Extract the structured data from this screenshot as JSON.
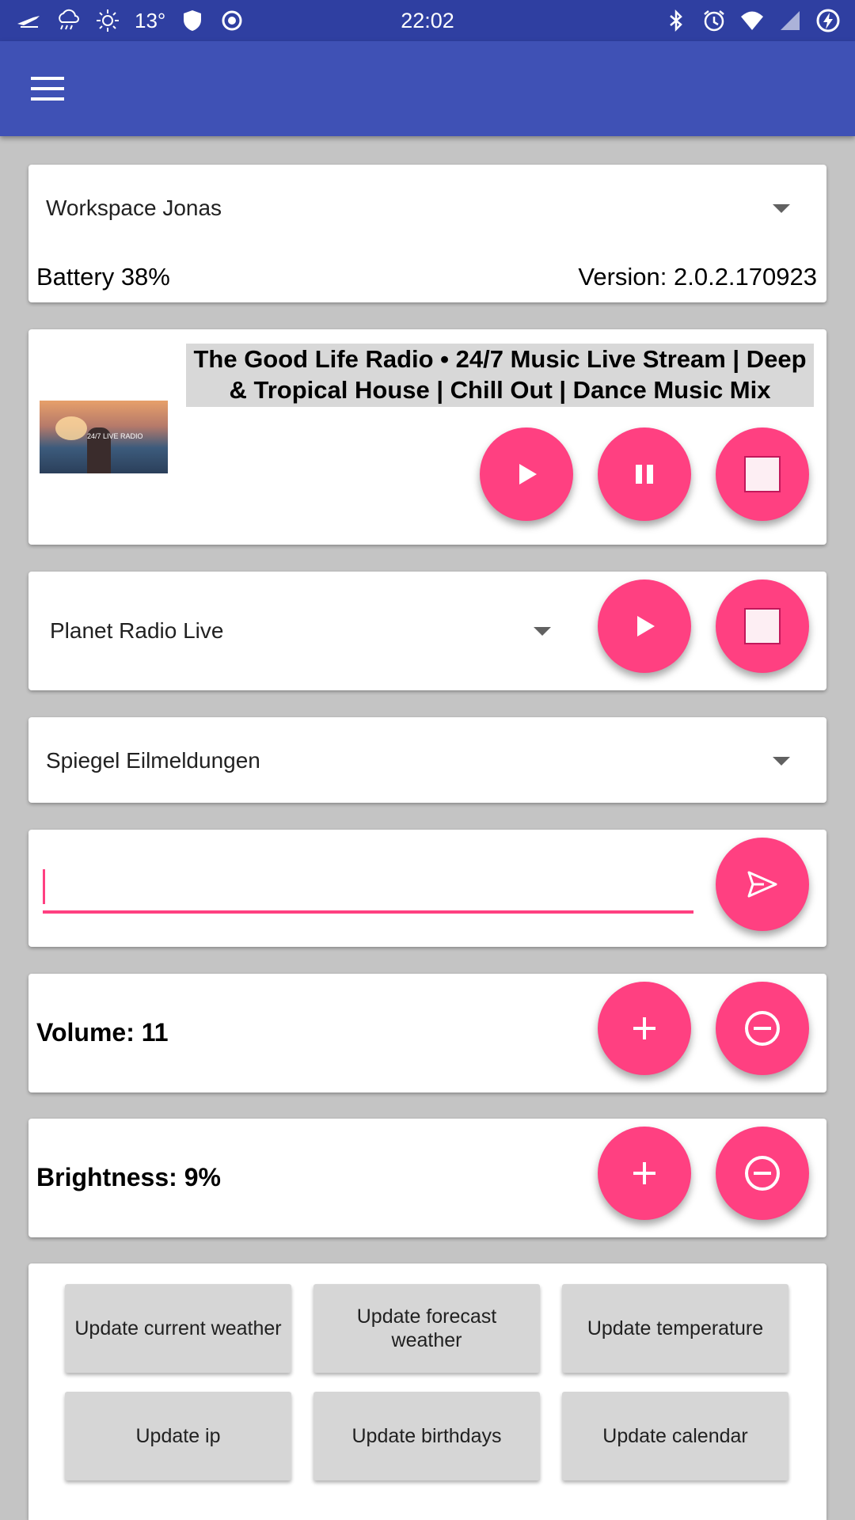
{
  "status_bar": {
    "time": "22:02",
    "temperature": "13°",
    "left_icons": [
      "airplane-logo-icon",
      "rain-cloud-icon",
      "sun-icon",
      "shield-icon",
      "record-icon"
    ],
    "right_icons": [
      "bluetooth-icon",
      "alarm-icon",
      "wifi-icon",
      "signal-icon",
      "battery-charging-icon"
    ]
  },
  "app_bar": {
    "menu_icon": "hamburger-menu-icon"
  },
  "workspace": {
    "selected": "Workspace Jonas",
    "battery": "Battery 38%",
    "version": "Version: 2.0.2.170923"
  },
  "now_playing": {
    "title": "The Good Life Radio • 24/7 Music Live Stream | Deep & Tropical House | Chill Out | Dance Music Mix",
    "thumb_text": "24/7 LIVE RADIO"
  },
  "radio": {
    "selected": "Planet Radio Live"
  },
  "news": {
    "selected": "Spiegel Eilmeldungen"
  },
  "message": {
    "value": "",
    "placeholder": ""
  },
  "volume": {
    "label": "Volume: 11"
  },
  "brightness": {
    "label": "Brightness: 9%"
  },
  "updates": [
    "Update current weather",
    "Update forecast weather",
    "Update temperature",
    "Update ip",
    "Update birthdays",
    "Update calendar"
  ],
  "colors": {
    "primary": "#3f51b5",
    "primary_dark": "#2f3fa1",
    "accent": "#ff4081",
    "background": "#c4c4c4"
  }
}
